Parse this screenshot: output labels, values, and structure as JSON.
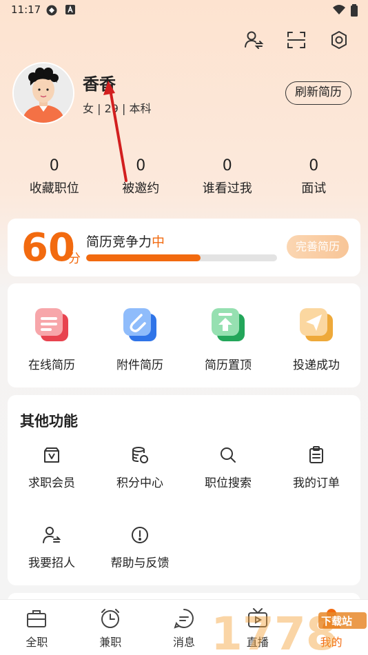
{
  "status": {
    "time": "11:17"
  },
  "profile": {
    "name": "香香",
    "info": "女 | 29 | 本科",
    "refresh_label": "刷新简历"
  },
  "stats": [
    {
      "num": "0",
      "label": "收藏职位"
    },
    {
      "num": "0",
      "label": "被邀约"
    },
    {
      "num": "0",
      "label": "谁看过我"
    },
    {
      "num": "0",
      "label": "面试"
    }
  ],
  "score": {
    "value": "60",
    "unit": "分",
    "title": "简历竞争力",
    "level": "中",
    "progress": 0.6,
    "improve_label": "完善简历"
  },
  "actions": [
    {
      "label": "在线简历",
      "icon": "resume-doc-icon",
      "color": "#f2646e"
    },
    {
      "label": "附件简历",
      "icon": "attachment-icon",
      "color": "#4f8ef7"
    },
    {
      "label": "简历置顶",
      "icon": "pin-top-icon",
      "color": "#3cc070"
    },
    {
      "label": "投递成功",
      "icon": "send-icon",
      "color": "#f4b04c"
    }
  ],
  "other": {
    "title": "其他功能",
    "items": [
      {
        "label": "求职会员",
        "icon": "vip-icon"
      },
      {
        "label": "积分中心",
        "icon": "coins-icon"
      },
      {
        "label": "职位搜索",
        "icon": "search-icon"
      },
      {
        "label": "我的订单",
        "icon": "order-icon"
      },
      {
        "label": "我要招人",
        "icon": "recruit-icon"
      },
      {
        "label": "帮助与反馈",
        "icon": "help-icon"
      }
    ]
  },
  "tabs": [
    {
      "label": "全职",
      "icon": "briefcase-icon"
    },
    {
      "label": "兼职",
      "icon": "clock-icon"
    },
    {
      "label": "消息",
      "icon": "message-icon"
    },
    {
      "label": "直播",
      "icon": "tv-icon"
    },
    {
      "label": "我的",
      "icon": "user-icon",
      "active": true
    }
  ],
  "watermark": {
    "text": "1778 下载站"
  },
  "colors": {
    "accent": "#f26a0f",
    "annotation": "#d21f1f"
  }
}
